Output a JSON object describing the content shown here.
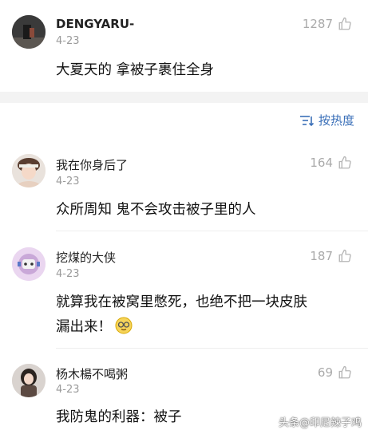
{
  "comments_top": {
    "username": "DENGYARU-",
    "date": "4-23",
    "likes": "1287",
    "text": "大夏天的 拿被子裹住全身"
  },
  "sort": {
    "label": "按热度"
  },
  "replies": [
    {
      "username": "我在你身后了",
      "date": "4-23",
      "likes": "164",
      "text": "众所周知 鬼不会攻击被子里的人"
    },
    {
      "username": "挖煤的大侠",
      "date": "4-23",
      "likes": "187",
      "text_line1": "就算我在被窝里憋死，也绝不把一块皮肤",
      "text_line2": "漏出来！",
      "emoji": "sweat-smile-emoji"
    },
    {
      "username": "杨木楊不喝粥",
      "date": "4-23",
      "likes": "69",
      "text": "我防鬼的利器：被子"
    }
  ],
  "watermark": "头条@印尼辣子鸡",
  "colors": {
    "accent": "#3a6fb8",
    "muted": "#9a9a9a",
    "band": "#f3f3f3"
  }
}
